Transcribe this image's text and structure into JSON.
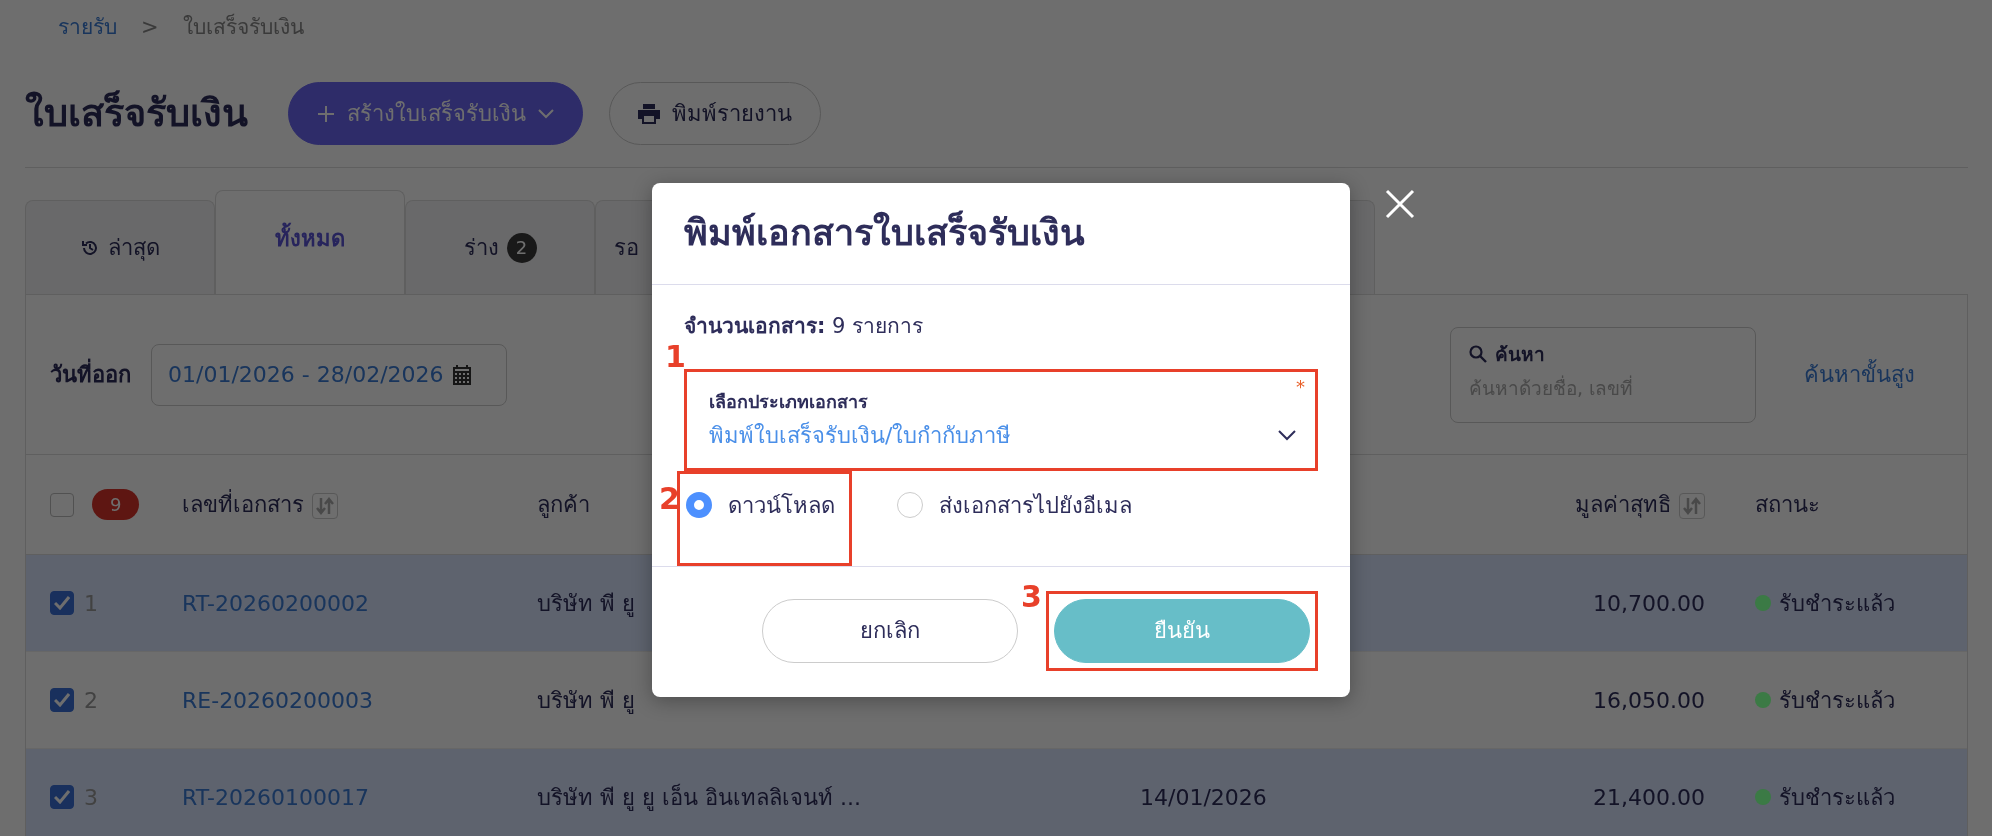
{
  "breadcrumb": {
    "items": [
      {
        "label": "รายรับ",
        "link": true
      },
      {
        "label": "ใบเสร็จรับเงิน",
        "link": false
      }
    ],
    "separator": ">"
  },
  "page_title": "ใบเสร็จรับเงิน",
  "actions": [
    {
      "kind": "create",
      "label": "สร้างใบเสร็จรับเงิน"
    },
    {
      "kind": "print",
      "label": "พิมพ์รายงาน"
    }
  ],
  "tabs": [
    {
      "kind": "history",
      "label": "ล่าสุด",
      "selected": false
    },
    {
      "kind": "plain",
      "label": "ทั้งหมด",
      "selected": true
    },
    {
      "kind": "count",
      "label": "ร่าง",
      "count": "2",
      "selected": false
    },
    {
      "kind": "plain",
      "label": "รอ",
      "selected": false
    }
  ],
  "filters": {
    "date_label": "วันที่ออก",
    "date_range": "01/01/2026 - 28/02/2026",
    "search_label": "ค้นหา",
    "search_placeholder": "ค้นหาด้วยชื่อ, เลขที่",
    "advanced_link": "ค้นหาขั้นสูง"
  },
  "table": {
    "select_all_checked": false,
    "selected_count": "9",
    "columns": [
      {
        "label": "เลขที่เอกสาร",
        "sortable": true
      },
      {
        "label": "ลูกค้า",
        "sortable": false
      },
      {
        "label": "มูลค่าสุทธิ",
        "sortable": true
      },
      {
        "label": "สถานะ",
        "sortable": false
      }
    ],
    "rows": [
      {
        "checked": true,
        "index": "1",
        "doc_no": "RT-20260200002",
        "customer": "บริษัท พี ยู",
        "amount": "10,700.00",
        "status": "รับชำระแล้ว",
        "color": "#3b7a45"
      },
      {
        "checked": true,
        "index": "2",
        "doc_no": "RE-20260200003",
        "customer": "บริษัท พี ยู",
        "amount": "16,050.00",
        "status": "รับชำระแล้ว",
        "color": "#3b7a45"
      },
      {
        "checked": true,
        "index": "3",
        "doc_no": "RT-20260100017",
        "customer": "บริษัท พี ยู ยู เอ็น อินเทลลิเจนท์ ...",
        "date": "14/01/2026",
        "amount": "21,400.00",
        "status": "รับชำระแล้ว",
        "color": "#3b7a45"
      }
    ]
  },
  "modal": {
    "title": "พิมพ์เอกสารใบเสร็จรับเงิน",
    "count_text": "**จำนวนเอกสาร:** 9 รายการ",
    "select": {
      "label": "เลือกประเภทเอกสาร",
      "required_mark": "*",
      "value": "พิมพ์ใบเสร็จรับเงิน/ใบกำกับภาษี",
      "annotation": "1"
    },
    "options": [
      {
        "label": "ดาวน์โหลด",
        "selected": true,
        "annotation": "2"
      },
      {
        "label": "ส่งเอกสารไปยังอีเมล",
        "selected": false
      }
    ],
    "buttons": [
      {
        "kind": "cancel",
        "label": "ยกเลิก"
      },
      {
        "kind": "confirm",
        "label": "ยืนยัน",
        "annotation": "3"
      }
    ]
  }
}
